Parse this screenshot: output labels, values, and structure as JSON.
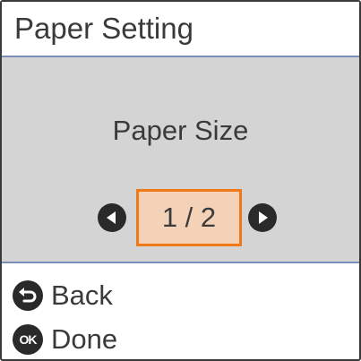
{
  "header": {
    "title": "Paper Setting"
  },
  "setting": {
    "label": "Paper Size"
  },
  "pager": {
    "current": "1",
    "separator": " / ",
    "total": "2",
    "text": "1 / 2",
    "prev_icon": "left-arrow-icon",
    "next_icon": "right-arrow-icon"
  },
  "soft_keys": {
    "back": {
      "label": "Back",
      "icon": "back-icon"
    },
    "done": {
      "label": "Done",
      "icon": "ok-icon",
      "icon_text": "OK"
    }
  },
  "colors": {
    "header_rule": "#7a8fb8",
    "panel_background": "#d4d4d4",
    "highlight_fill": "#f4d2b8",
    "highlight_border": "#f07a1a",
    "text": "#3a3a3a"
  }
}
